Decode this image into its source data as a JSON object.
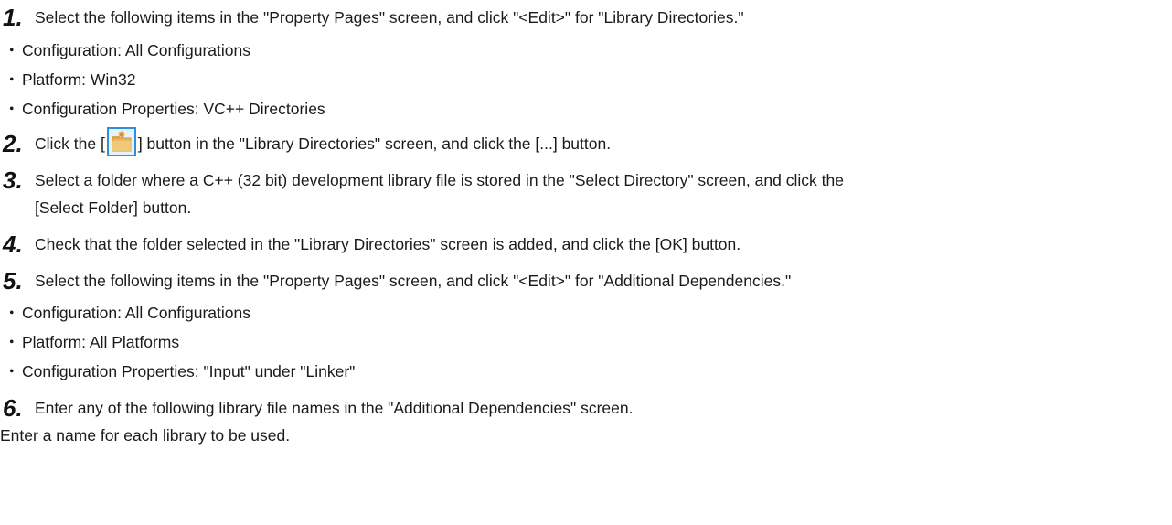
{
  "steps": [
    {
      "num": "1.",
      "text": "Select the following items in the \"Property Pages\" screen, and click \"<Edit>\" for \"Library Directories.\"",
      "bullets": [
        "Configuration: All Configurations",
        "Platform: Win32",
        "Configuration Properties: VC++ Directories"
      ]
    },
    {
      "num": "2.",
      "text_before": "Click the [",
      "icon": "new-folder-icon",
      "text_after": "] button in the \"Library Directories\" screen, and click the [...] button."
    },
    {
      "num": "3.",
      "text": "Select a folder where a C++ (32 bit) development library file is stored in the \"Select Directory\" screen, and click the",
      "text_line2": "[Select Folder] button."
    },
    {
      "num": "4.",
      "text": "Check that the folder selected in the \"Library Directories\" screen is added, and click the [OK] button."
    },
    {
      "num": "5.",
      "text": "Select the following items in the \"Property Pages\" screen, and click \"<Edit>\" for \"Additional Dependencies.\"",
      "bullets": [
        "Configuration: All Configurations",
        "Platform: All Platforms",
        "Configuration Properties: \"Input\" under \"Linker\""
      ]
    },
    {
      "num": "6.",
      "text": "Enter any of the following library file names in the \"Additional Dependencies\" screen."
    }
  ],
  "bullet_char": "・",
  "closing_text": "Enter a name for each library to be used.",
  "colors": {
    "text": "#1a1a1a",
    "icon_border": "#2f8fd8",
    "icon_bg": "#e6f3fd",
    "folder": "#e9b860"
  }
}
